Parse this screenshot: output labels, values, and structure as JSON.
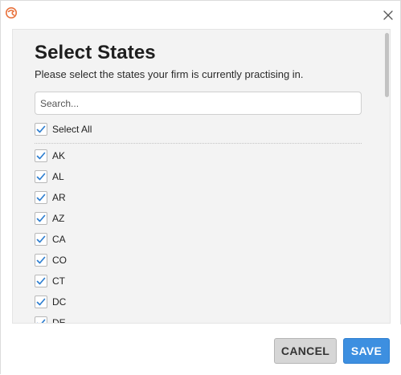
{
  "dialog": {
    "title": "Select States",
    "description": "Please select the states your firm is currently practising in.",
    "search_placeholder": "Search...",
    "select_all": {
      "label": "Select All",
      "checked": true
    },
    "states": [
      {
        "label": "AK",
        "checked": true
      },
      {
        "label": "AL",
        "checked": true
      },
      {
        "label": "AR",
        "checked": true
      },
      {
        "label": "AZ",
        "checked": true
      },
      {
        "label": "CA",
        "checked": true
      },
      {
        "label": "CO",
        "checked": true
      },
      {
        "label": "CT",
        "checked": true
      },
      {
        "label": "DC",
        "checked": true
      },
      {
        "label": "DE",
        "checked": true
      }
    ]
  },
  "footer": {
    "cancel_label": "CANCEL",
    "save_label": "SAVE"
  },
  "icons": {
    "app_logo": "app-logo-icon",
    "close": "close-icon",
    "check": "checkmark-icon"
  },
  "colors": {
    "accent": "#3d8fe0",
    "check": "#2f7fd0",
    "logo": "#e8703a",
    "panel_bg": "#f3f3f3"
  }
}
